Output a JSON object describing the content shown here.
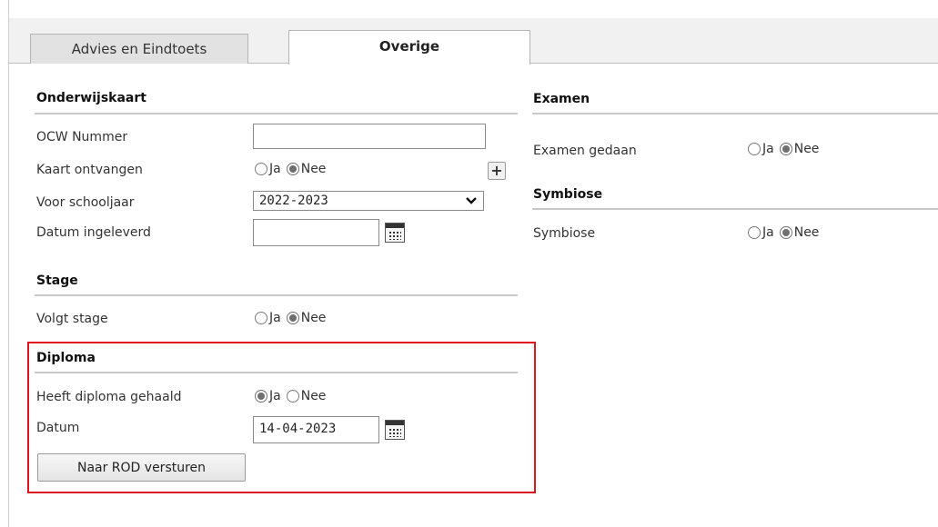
{
  "tabs": [
    {
      "label": "Advies en Eindtoets",
      "active": false
    },
    {
      "label": "Overige",
      "active": true
    }
  ],
  "onderwijskaart": {
    "title": "Onderwijskaart",
    "ocw_label": "OCW Nummer",
    "ocw_value": "",
    "kaart_label": "Kaart ontvangen",
    "kaart_options": [
      "Ja",
      "Nee"
    ],
    "kaart_selected": "Nee",
    "schooljaar_label": "Voor schooljaar",
    "schooljaar_value": "2022-2023",
    "datum_label": "Datum ingeleverd",
    "datum_value": ""
  },
  "stage": {
    "title": "Stage",
    "volgt_label": "Volgt stage",
    "options": [
      "Ja",
      "Nee"
    ],
    "selected": "Nee"
  },
  "diploma": {
    "title": "Diploma",
    "gehaald_label": "Heeft diploma gehaald",
    "options": [
      "Ja",
      "Nee"
    ],
    "selected": "Ja",
    "datum_label": "Datum",
    "datum_value": "14-04-2023",
    "send_button": "Naar ROD versturen",
    "highlight_color": "#e0141e"
  },
  "examen": {
    "title": "Examen",
    "gedaan_label": "Examen gedaan",
    "options": [
      "Ja",
      "Nee"
    ],
    "selected": "Nee"
  },
  "symbiose": {
    "title": "Symbiose",
    "label": "Symbiose",
    "options": [
      "Ja",
      "Nee"
    ],
    "selected": "Nee"
  },
  "icons": {
    "calendar": "calendar-icon",
    "plus": "plus-icon",
    "dropdown": "chevron-down-icon"
  }
}
